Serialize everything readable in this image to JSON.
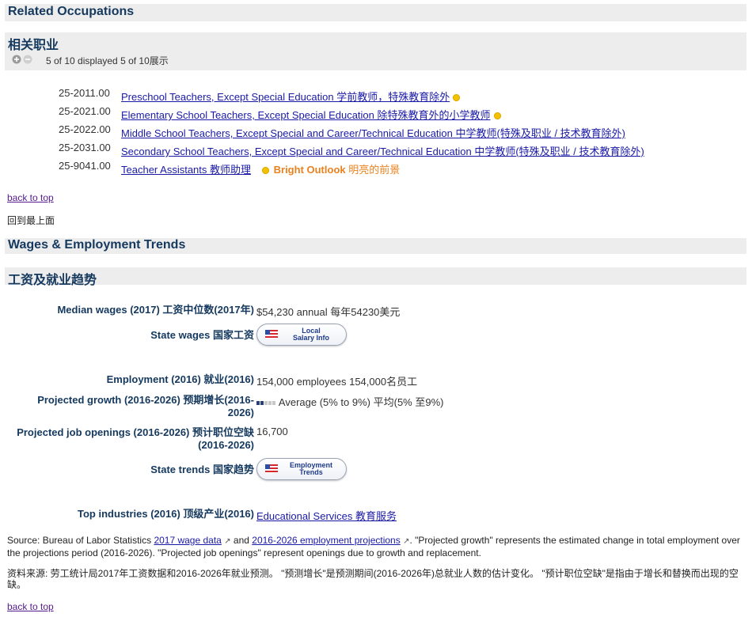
{
  "related": {
    "title_en": "Related Occupations",
    "title_zh": "相关职业",
    "display_count": "5 of 10 displayed 5 of 10展示",
    "items": [
      {
        "code": "25-2011.00",
        "label": "Preschool Teachers, Except Special Education 学前教师，特殊教育除外",
        "bright": false
      },
      {
        "code": "25-2021.00",
        "label": "Elementary School Teachers, Except Special Education 除特殊教育外的小学教师",
        "bright": false
      },
      {
        "code": "25-2022.00",
        "label": "Middle School Teachers, Except Special and Career/Technical Education 中学教师(特殊及职业 / 技术教育除外)",
        "bright": false
      },
      {
        "code": "25-2031.00",
        "label": "Secondary School Teachers, Except Special and Career/Technical Education 中学教师(特殊及职业 / 技术教育除外)",
        "bright": false
      },
      {
        "code": "25-9041.00",
        "label": "Teacher Assistants 教师助理",
        "bright": true
      }
    ],
    "bright_outlook_en": "Bright Outlook",
    "bright_outlook_zh": "明亮的前景"
  },
  "nav": {
    "back_to_top": "back to top",
    "back_to_top_zh": "回到最上面"
  },
  "wages": {
    "title_en": "Wages & Employment Trends",
    "title_zh": "工资及就业趋势",
    "median_label": "Median wages (2017) 工资中位数(2017年)",
    "median_value": "$54,230 annual 每年54230美元",
    "state_wages_label": "State wages 国家工资",
    "state_wages_btn_line1": "Local",
    "state_wages_btn_line2": "Salary Info",
    "employment_label": "Employment (2016) 就业(2016)",
    "employment_value": "154,000 employees 154,000名员工",
    "growth_label_1": "Projected growth (2016-2026) 预期增长(2016-",
    "growth_label_2": "2026)",
    "growth_value": "Average (5% to 9%) 平均(5% 至9%)",
    "growth_level": 2,
    "growth_max": 5,
    "openings_label_1": "Projected job openings (2016-2026) 预计职位空缺",
    "openings_label_2": "(2016-2026)",
    "openings_value": "16,700",
    "state_trends_label": "State trends 国家趋势",
    "state_trends_btn_line1": "Employment",
    "state_trends_btn_line2": "Trends",
    "industries_label": "Top industries (2016) 顶级产业(2016)",
    "industries_value": "Educational Services 教育服务"
  },
  "source": {
    "prefix": "Source: Bureau of Labor Statistics ",
    "link1": "2017 wage data",
    "and": " and ",
    "link2": "2016-2026 employment projections",
    "rest": ". \"Projected growth\" represents the estimated change in total employment over the projections period (2016-2026). \"Projected job openings\" represent openings due to growth and replacement.",
    "zh": "资料来源: 劳工统计局2017年工资数据和2016-2026年就业预测。 \"预测增长\"是预测期间(2016-2026年)总就业人数的估计变化。 \"预计职位空缺\"是指由于增长和替换而出现的空缺。"
  },
  "colors": {
    "heading": "#15395e",
    "link": "#1a1aa6",
    "bright": "#e8821f",
    "bar": "#ededed"
  }
}
